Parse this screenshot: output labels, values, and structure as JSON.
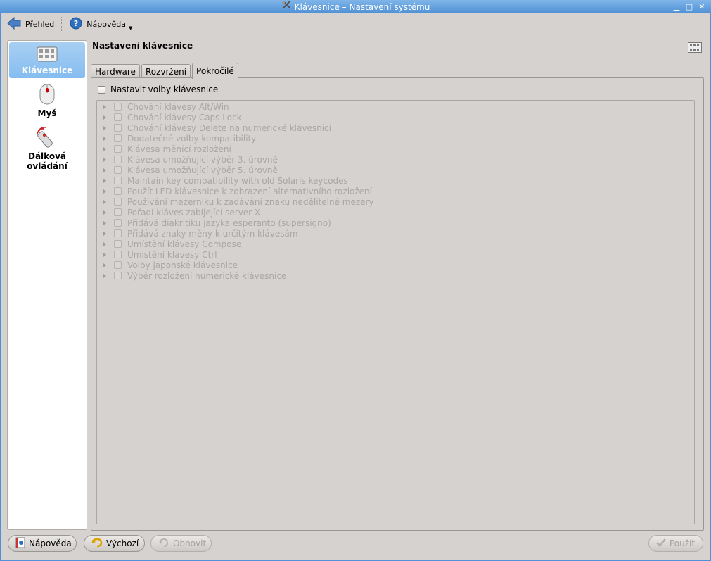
{
  "window": {
    "title": "Klávesnice – Nastavení systému",
    "min_glyph": "▁",
    "max_glyph": "□",
    "close_glyph": "✕"
  },
  "toolbar": {
    "overview_label": "Přehled",
    "help_label": "Nápověda"
  },
  "sidebar": {
    "items": [
      {
        "label": "Klávesnice",
        "icon": "keyboard-icon",
        "selected": true
      },
      {
        "label": "Myš",
        "icon": "mouse-icon",
        "selected": false
      },
      {
        "label": "Dálková ovládání",
        "icon": "remote-control-icon",
        "selected": false
      }
    ]
  },
  "panel": {
    "title": "Nastavení klávesnice"
  },
  "tabs": [
    {
      "label": "Hardware",
      "active": false
    },
    {
      "label": "Rozvržení",
      "active": false
    },
    {
      "label": "Pokročilé",
      "active": true
    }
  ],
  "advanced": {
    "enable_label": "Nastavit volby klávesnice",
    "enable_checked": false,
    "options": [
      "Chování klávesy Alt/Win",
      "Chování klávesy Caps Lock",
      "Chování klávesy Delete na numerické klávesnici",
      "Dodatečné volby kompatibility",
      "Klávesa měnící rozložení",
      "Klávesa umožňující výběr 3. úrovně",
      "Klávesa umožňující výběr 5. úrovně",
      "Maintain key compatibility with old Solaris keycodes",
      "Použít LED klávesnice k zobrazení alternativního rozložení",
      "Používání mezerníku k zadávání znaku nedělitelné mezery",
      "Pořadí kláves zabíjející server X",
      "Přidává diakritiku jazyka esperanto (supersigno)",
      "Přidává znaky měny k určitým klávesám",
      "Umístění klávesy Compose",
      "Umístění klávesy Ctrl",
      "Volby japonské klávesnice",
      "Výběr rozložení numerické klávesnice"
    ]
  },
  "buttons": {
    "help": "Nápověda",
    "defaults": "Výchozí",
    "reset": "Obnovit",
    "apply": "Použít"
  },
  "colors": {
    "accent": "#4f90d6",
    "selection": "#85bdf0",
    "window_bg": "#d6d2d0",
    "disabled_text": "#aaa6a3"
  }
}
